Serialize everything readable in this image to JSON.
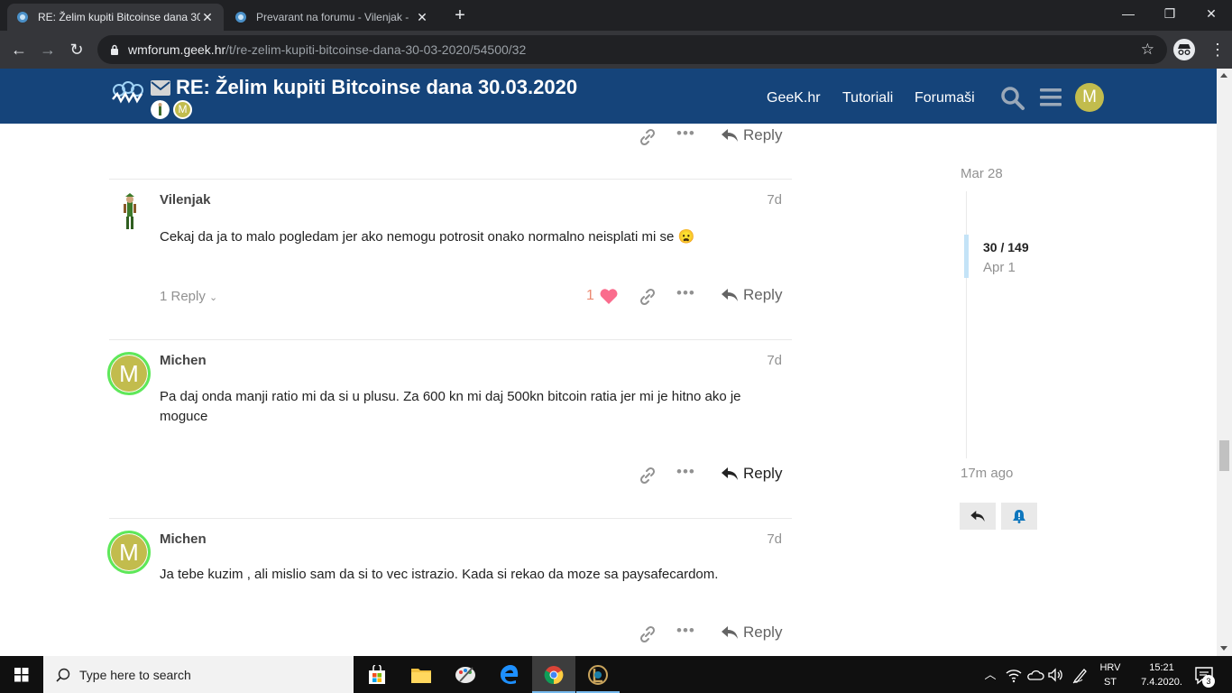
{
  "browser": {
    "tabs": [
      {
        "title": "RE: Želim kupiti Bitcoinse dana 30",
        "active": true
      },
      {
        "title": "Prevarant na forumu - Vilenjak - ",
        "active": false
      }
    ],
    "url_host": "wmforum.geek.hr",
    "url_path": "/t/re-zelim-kupiti-bitcoinse-dana-30-03-2020/54500/32"
  },
  "header": {
    "title": "RE: Želim kupiti Bitcoinse dana 30.03.2020",
    "participant_avatar_letter": "M",
    "nav": [
      "GeeK.hr",
      "Tutoriali",
      "Forumaši"
    ],
    "user_avatar_letter": "M",
    "brand_color": "#15447a"
  },
  "posts": [
    {
      "username": "Vilenjak",
      "date": "7d",
      "body": "Cekaj da ja to malo pogledam jer ako nemogu potrosit onako normalno neisplati mi se",
      "emoji": "😦",
      "replies": "1 Reply",
      "likes": "1",
      "reply_label": "Reply"
    },
    {
      "username": "Michen",
      "avatar_letter": "M",
      "date": "7d",
      "body": "Pa daj onda manji ratio mi da si u plusu. Za 600 kn mi daj 500kn bitcoin ratia jer mi je hitno ako je moguce",
      "reply_label": "Reply"
    },
    {
      "username": "Michen",
      "avatar_letter": "M",
      "date": "7d",
      "body": "Ja tebe kuzim , ali mislio sam da si to vec istrazio. Kada si rekao da moze sa paysafecardom.",
      "reply_label": "Reply"
    }
  ],
  "top_actions": {
    "reply_label": "Reply"
  },
  "timeline": {
    "start_date": "Mar 28",
    "position": "30 / 149",
    "current_date": "Apr 1",
    "last_activity": "17m ago"
  },
  "taskbar": {
    "search_placeholder": "Type here to search",
    "lang_line1": "HRV",
    "lang_line2": "ST",
    "time": "15:21",
    "date": "7.4.2020.",
    "notifications": "3"
  }
}
